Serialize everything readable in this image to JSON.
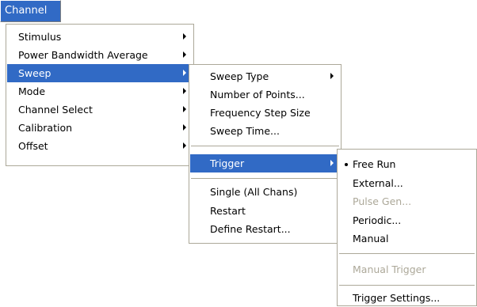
{
  "menubar": {
    "channel_label": "Channel"
  },
  "channel_menu": {
    "items": [
      {
        "label": "Stimulus"
      },
      {
        "label": "Power Bandwidth Average"
      },
      {
        "label": "Sweep"
      },
      {
        "label": "Mode"
      },
      {
        "label": "Channel Select"
      },
      {
        "label": "Calibration"
      },
      {
        "label": "Offset"
      }
    ]
  },
  "sweep_menu": {
    "items": [
      {
        "label": "Sweep Type"
      },
      {
        "label": "Number of Points..."
      },
      {
        "label": "Frequency Step Size"
      },
      {
        "label": "Sweep Time..."
      },
      {
        "label": "Trigger"
      },
      {
        "label": "Single (All Chans)"
      },
      {
        "label": "Restart"
      },
      {
        "label": "Define Restart..."
      }
    ]
  },
  "trigger_menu": {
    "items": [
      {
        "label": "Free Run",
        "checked": true
      },
      {
        "label": "External..."
      },
      {
        "label": "Pulse Gen...",
        "disabled": true
      },
      {
        "label": "Periodic..."
      },
      {
        "label": "Manual"
      },
      {
        "label": "Manual Trigger",
        "disabled": true
      },
      {
        "label": "Trigger Settings..."
      }
    ]
  },
  "colors": {
    "highlight": "#316ac5",
    "highlight_text": "#ffffff",
    "disabled_text": "#aca899",
    "menu_border": "#aca899"
  }
}
